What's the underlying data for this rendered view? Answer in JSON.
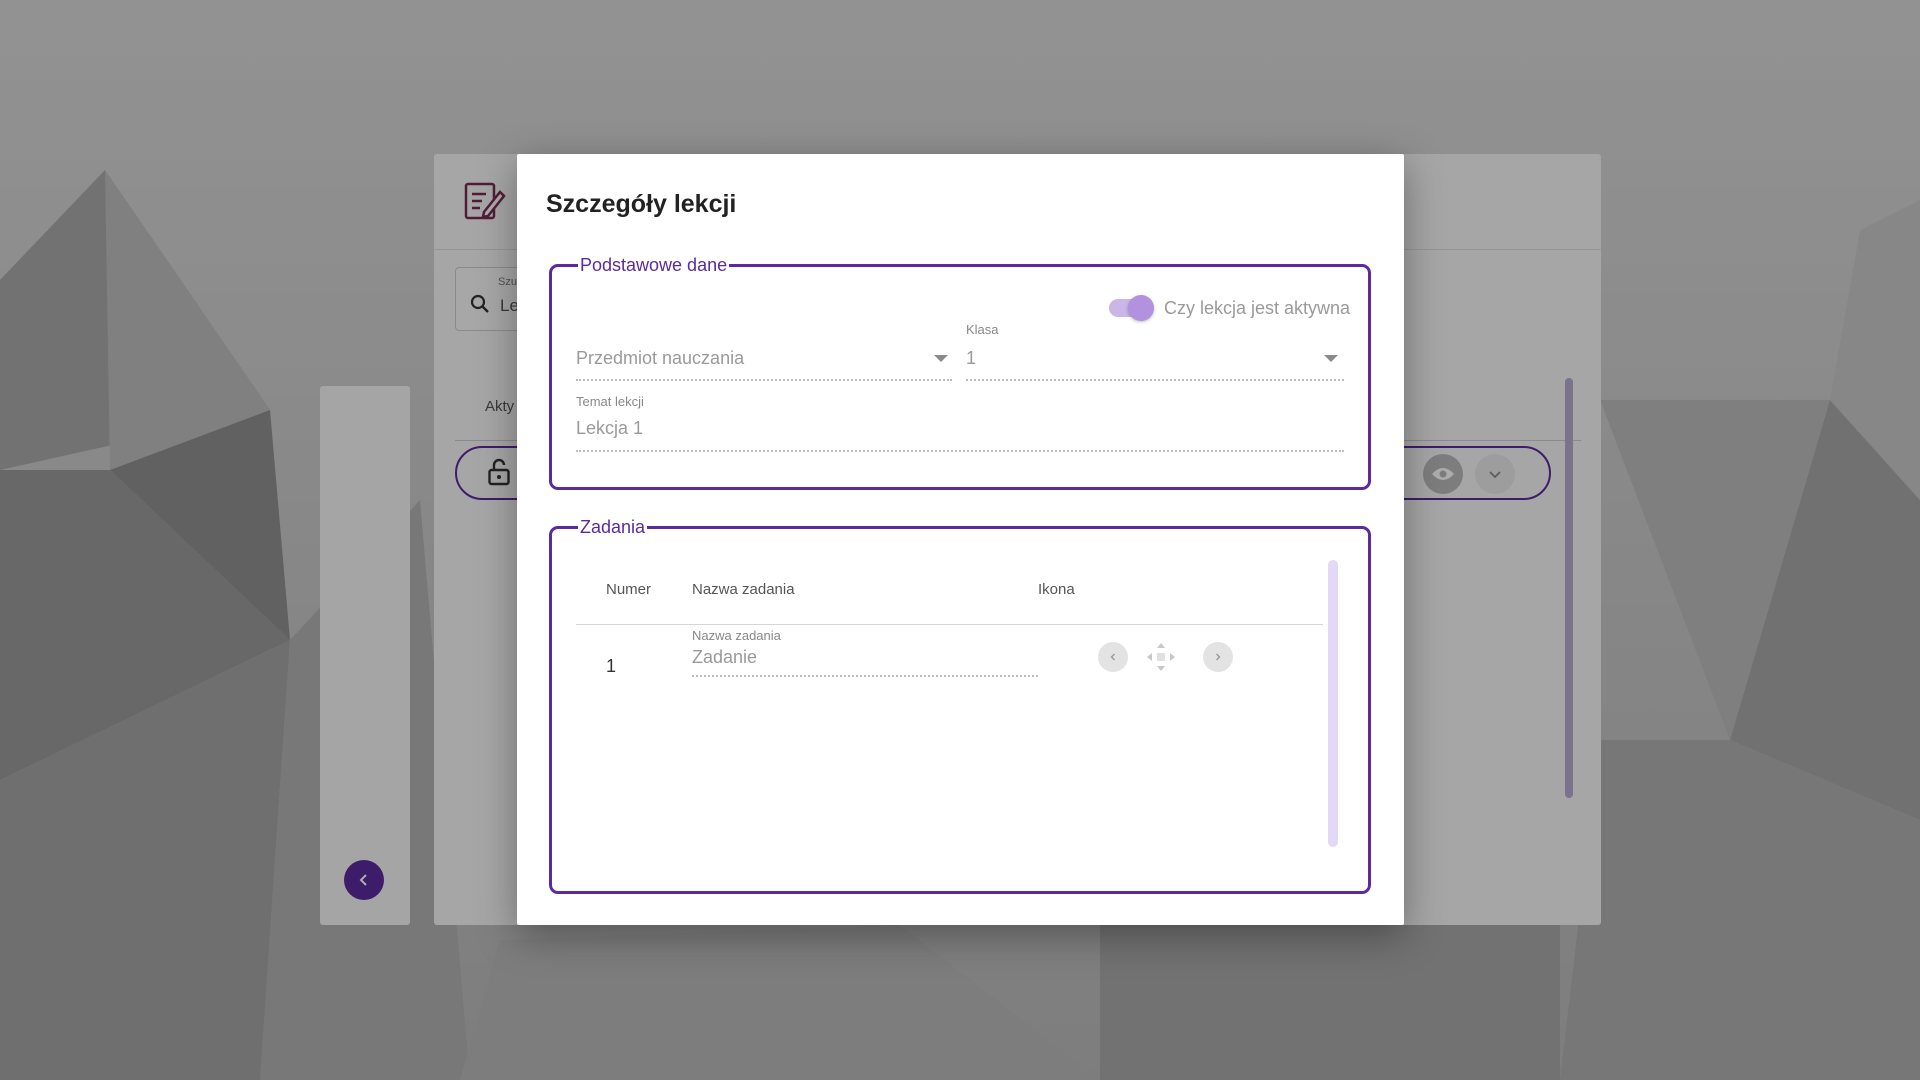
{
  "background_page": {
    "search": {
      "label": "Szu",
      "value": "Le"
    },
    "tab_active": "Akty"
  },
  "dialog": {
    "title": "Szczegóły lekcji",
    "basic_section": {
      "legend": "Podstawowe dane",
      "active_toggle": {
        "label": "Czy lekcja jest aktywna",
        "checked": true
      },
      "subject": {
        "placeholder": "Przedmiot nauczania",
        "value": ""
      },
      "class": {
        "label": "Klasa",
        "value": "1"
      },
      "topic": {
        "label": "Temat lekcji",
        "value": "Lekcja 1"
      }
    },
    "tasks_section": {
      "legend": "Zadania",
      "columns": [
        "Numer",
        "Nazwa zadania",
        "Ikona"
      ],
      "rows": [
        {
          "number": "1",
          "name_label": "Nazwa zadania",
          "name_value": "Zadanie"
        }
      ]
    }
  },
  "colors": {
    "accent": "#5b2a9c",
    "toggle_track": "#cbb6e8",
    "toggle_knob": "#b291de"
  },
  "icons": [
    "edit-document-icon",
    "search-icon",
    "lock-open-icon",
    "eye-icon",
    "chevron-down-icon",
    "chevron-left-icon",
    "move-icon",
    "chevron-right-icon"
  ]
}
